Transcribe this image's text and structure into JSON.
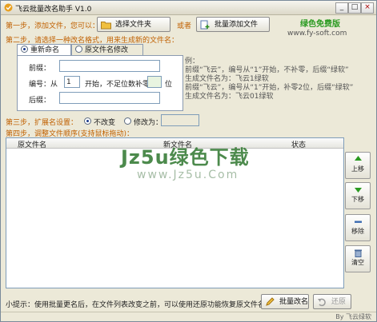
{
  "window": {
    "title": "飞云批量改名助手 V1.0",
    "controls": {
      "minimize": "_",
      "maximize": "□",
      "close": "×"
    }
  },
  "step1": {
    "label": "第一步，添加文件，您可以：",
    "select_folder_button": "选择文件夹",
    "or_text": "或者",
    "batch_add_button": "批量添加文件"
  },
  "brand": {
    "name": "绿色免费版",
    "site": "www.fy-soft.com"
  },
  "step2": {
    "label": "第二步，请选择一种改名格式，用来生成新的文件名：",
    "tabs": [
      {
        "label": "重新命名",
        "active": true
      },
      {
        "label": "原文件名修改",
        "active": false
      }
    ],
    "form": {
      "prefix_label": "前缀：",
      "prefix_value": "",
      "number_label": "编号：从",
      "number_value": "1",
      "number_mid": "开始，不足位数补零",
      "pad_value": "",
      "pad_unit": "位",
      "suffix_label": "后缀：",
      "suffix_value": ""
    },
    "example_lines": [
      "例：",
      "前缀“飞云”，编号从“1”开始，不补零，后缀“绿软”",
      "生成文件名为：飞云1绿软",
      "前缀“飞云”，编号从“1”开始，补零2位，后缀“绿软”",
      "生成文件名为：飞云01绿软"
    ]
  },
  "step3": {
    "label": "第三步，扩展名设置：",
    "option_keep": "不改变",
    "option_change": "修改为：",
    "keep_selected": true,
    "ext_value": ""
  },
  "step4": {
    "label": "第四步，调整文件顺序(支持鼠标拖动)：",
    "columns": [
      "原文件名",
      "新文件名",
      "状态"
    ],
    "rows": []
  },
  "side_buttons": {
    "up": "上移",
    "down": "下移",
    "remove": "移除",
    "clear": "清空"
  },
  "tip": "小提示：使用批量更名后，在文件列表改变之前，可以使用还原功能恢复原文件名",
  "bottom_buttons": {
    "rename": "批量改名",
    "restore": "还原"
  },
  "status": {
    "by": "By 飞云绿软"
  },
  "watermark": {
    "main": "Jz5u绿色下载",
    "sub": "www.Jz5u.Com"
  },
  "colors": {
    "step_label": "#c06000",
    "brand": "#2a9a20",
    "watermark": "#1a6a1a"
  }
}
